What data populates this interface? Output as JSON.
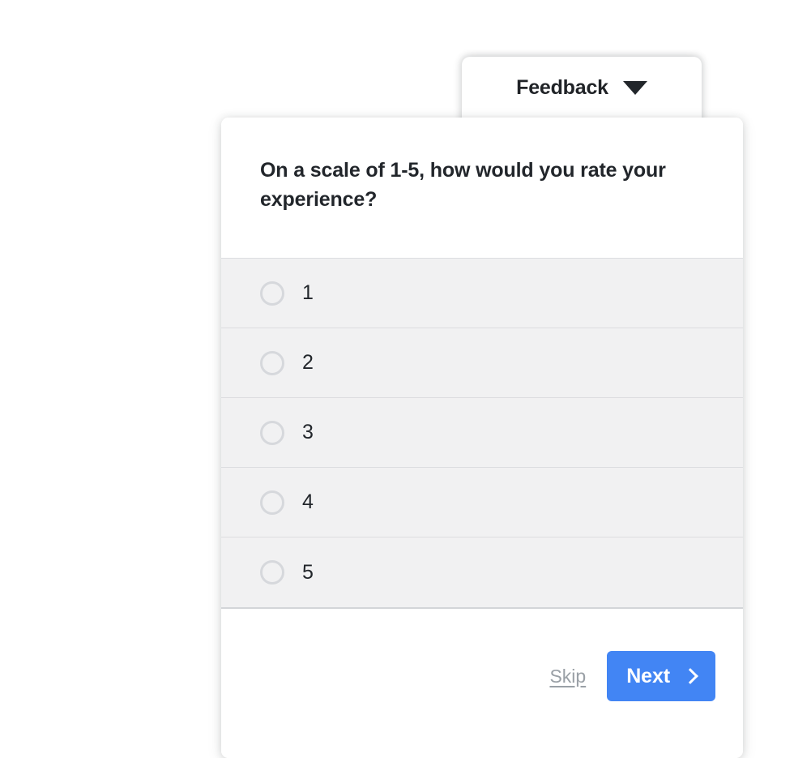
{
  "widget": {
    "tab": {
      "title": "Feedback",
      "caret_icon": "caret-down-icon",
      "expanded": true
    },
    "survey": {
      "question": "On a scale of 1-5, how would you rate your experience?",
      "options": [
        {
          "label": "1",
          "selected": false
        },
        {
          "label": "2",
          "selected": false
        },
        {
          "label": "3",
          "selected": false
        },
        {
          "label": "4",
          "selected": false
        },
        {
          "label": "5",
          "selected": false
        }
      ],
      "footer": {
        "skip_label": "Skip",
        "next_label": "Next",
        "next_chevron_icon": "chevron-right-icon"
      }
    }
  },
  "colors": {
    "accent": "#4285f4",
    "page_background": "#ffffff",
    "card_background": "#ffffff",
    "option_background": "#f1f1f2",
    "text_primary": "#22262b",
    "text_muted": "#9aa0a6",
    "radio_border": "#d6d8dc",
    "divider": "#dcdde0"
  }
}
